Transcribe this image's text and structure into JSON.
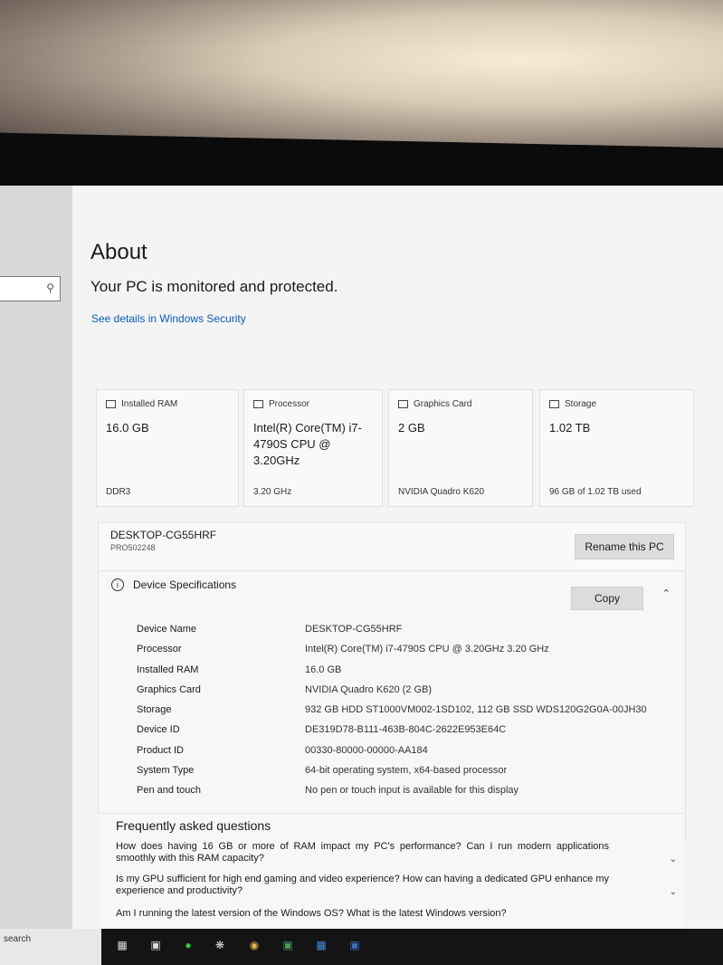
{
  "page": {
    "title": "About",
    "status": "Your PC is monitored and protected.",
    "security_link": "See details in Windows Security"
  },
  "cards": [
    {
      "label": "Installed RAM",
      "value": "16.0 GB",
      "detail": "DDR3",
      "icon": "memory-icon"
    },
    {
      "label": "Processor",
      "value": "Intel(R) Core(TM) i7-4790S CPU @ 3.20GHz",
      "detail": "3.20 GHz",
      "icon": "processor-icon"
    },
    {
      "label": "Graphics Card",
      "value": "2 GB",
      "detail": "NVIDIA Quadro K620",
      "icon": "graphics-card-icon"
    },
    {
      "label": "Storage",
      "value": "1.02 TB",
      "detail": "96 GB of 1.02 TB used",
      "icon": "storage-icon"
    }
  ],
  "pc": {
    "name": "DESKTOP-CG55HRF",
    "edition": "PRO502248",
    "rename_label": "Rename this PC"
  },
  "specs": {
    "header": "Device Specifications",
    "copy_label": "Copy",
    "rows": [
      {
        "key": "Device Name",
        "value": "DESKTOP-CG55HRF"
      },
      {
        "key": "Processor",
        "value": "Intel(R) Core(TM) i7-4790S CPU @ 3.20GHz   3.20 GHz"
      },
      {
        "key": "Installed RAM",
        "value": "16.0 GB"
      },
      {
        "key": "Graphics Card",
        "value": "NVIDIA Quadro K620 (2 GB)"
      },
      {
        "key": "Storage",
        "value": "932 GB HDD ST1000VM002-1SD102, 112 GB SSD WDS120G2G0A-00JH30"
      },
      {
        "key": "Device ID",
        "value": "DE319D78-B111-463B-804C-2622E953E64C"
      },
      {
        "key": "Product ID",
        "value": "00330-80000-00000-AA184"
      },
      {
        "key": "System Type",
        "value": "64-bit operating system, x64-based processor"
      },
      {
        "key": "Pen and touch",
        "value": "No pen or touch input is available for this display"
      }
    ]
  },
  "faq": {
    "title": "Frequently asked questions",
    "questions": [
      "How does having 16 GB or more of RAM impact my PC's performance? Can I run modern applications smoothly with this RAM capacity?",
      "Is my GPU sufficient for high end gaming and video experience? How can having a dedicated GPU enhance my experience and productivity?",
      "Am I running the latest version of the Windows OS? What is the latest Windows version?"
    ]
  },
  "taskbar": {
    "search_text": "search"
  }
}
